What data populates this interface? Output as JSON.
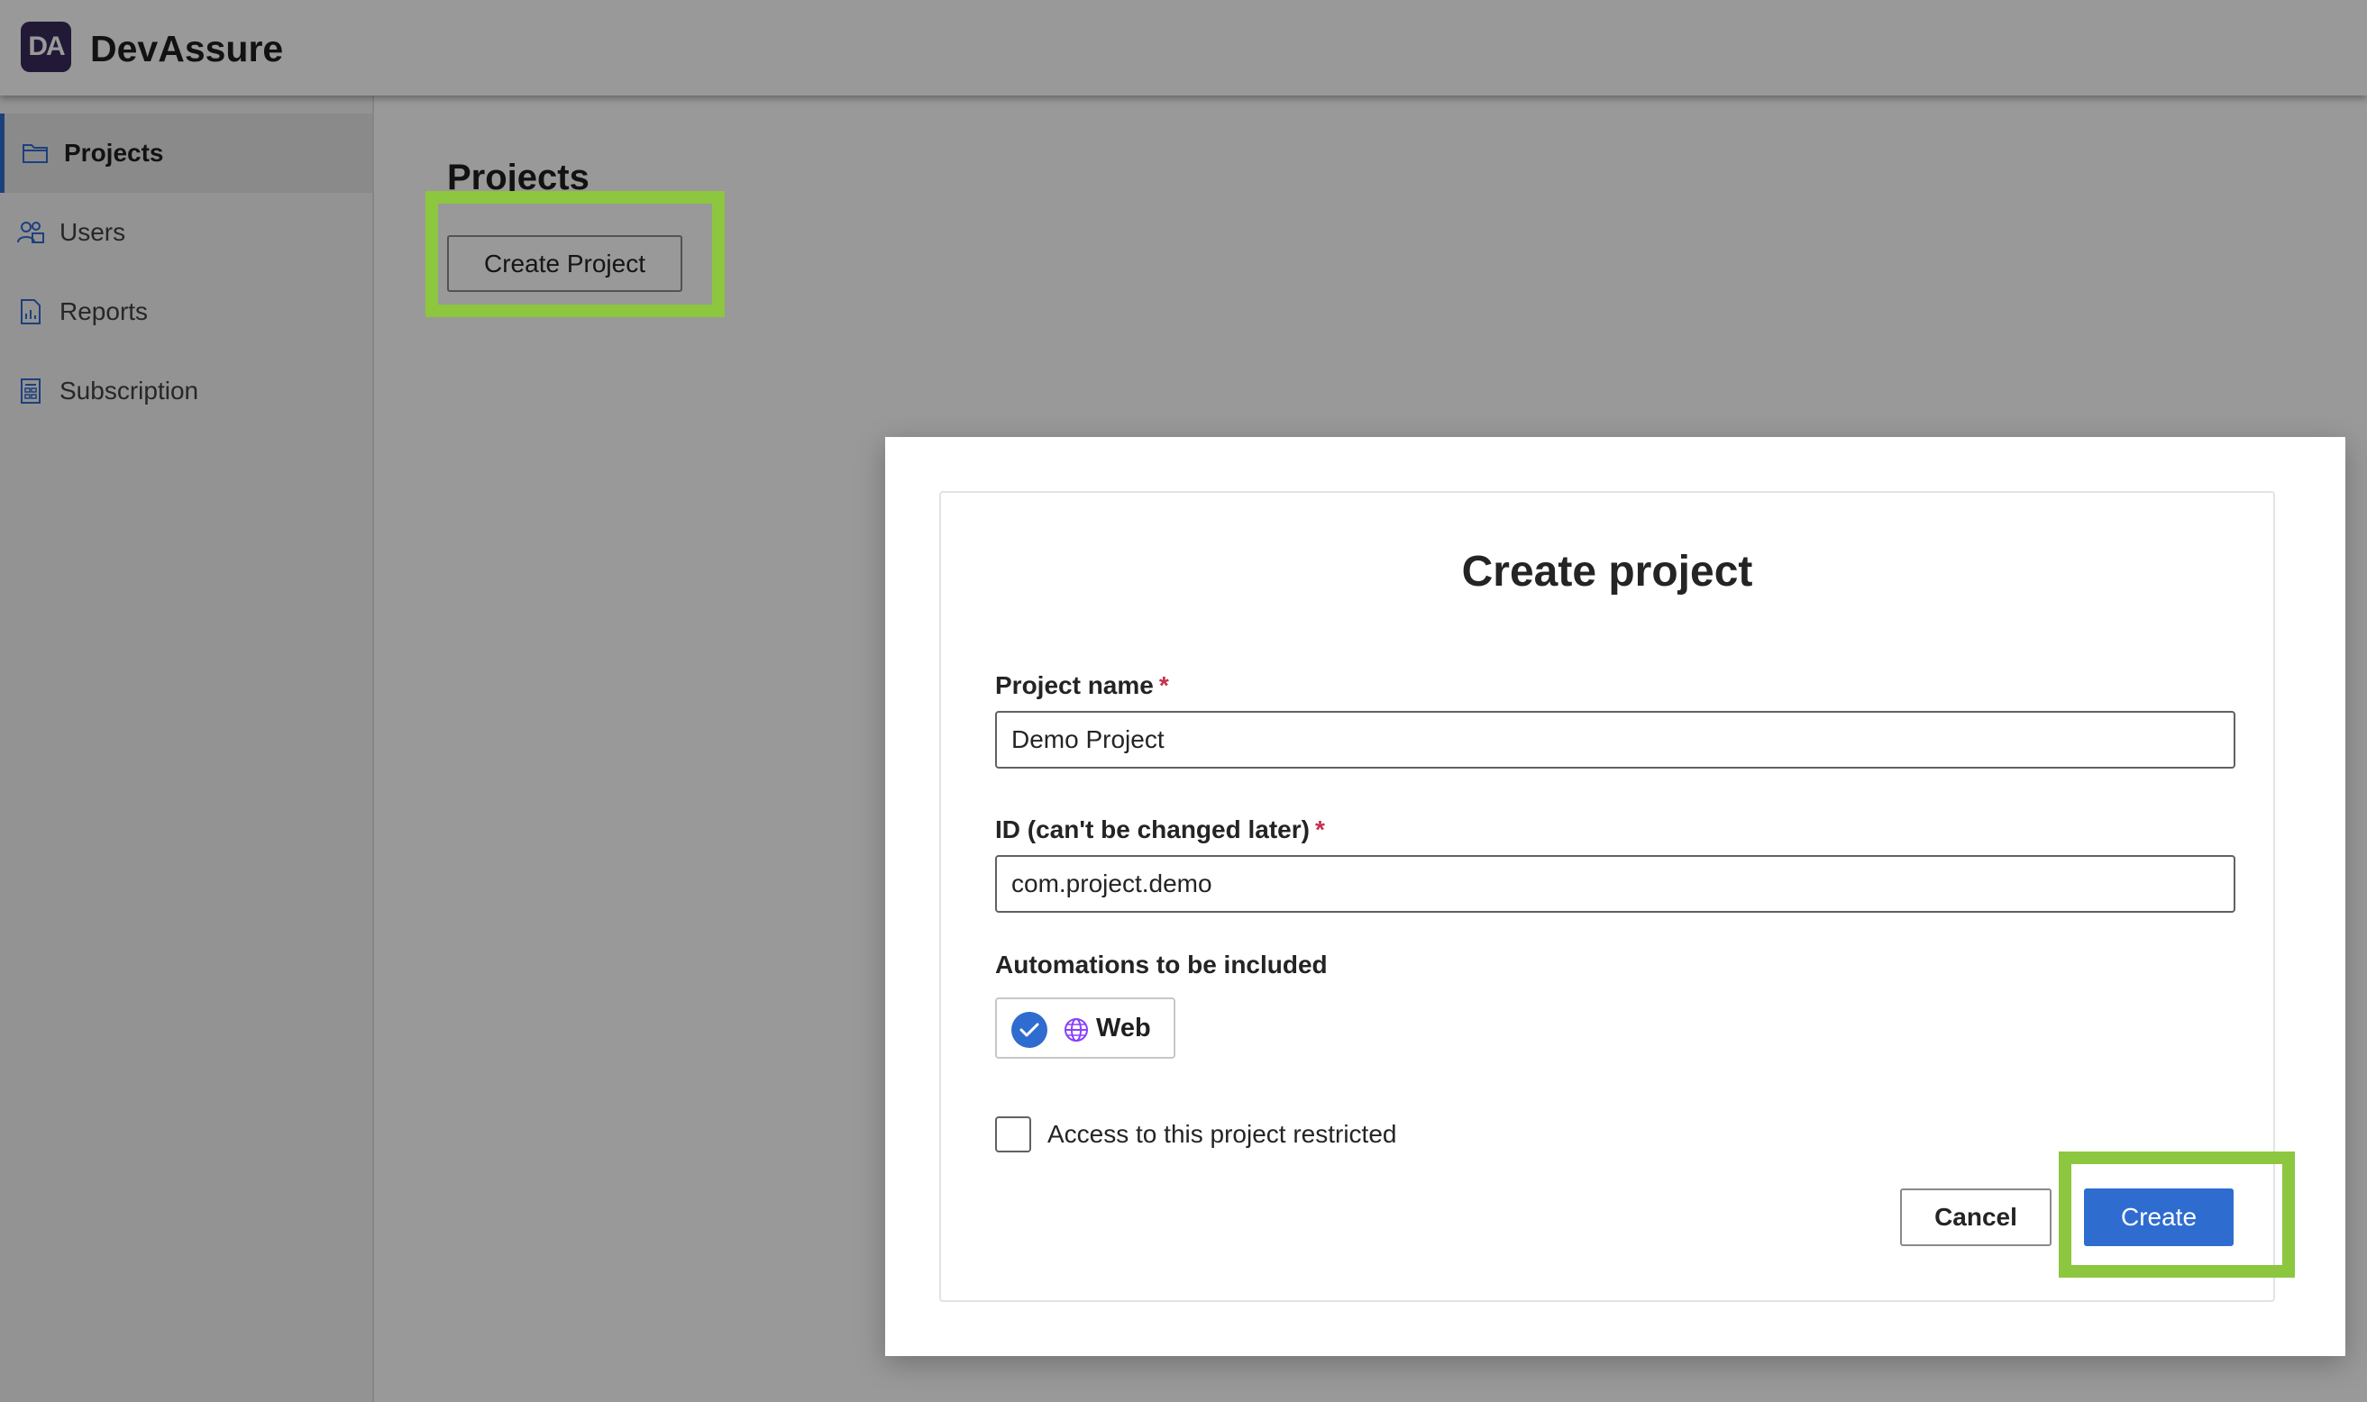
{
  "app": {
    "logo_text": "DA",
    "name": "DevAssure"
  },
  "sidebar": {
    "items": [
      {
        "label": "Projects",
        "icon": "folder-icon",
        "active": true
      },
      {
        "label": "Users",
        "icon": "users-icon",
        "active": false
      },
      {
        "label": "Reports",
        "icon": "report-icon",
        "active": false
      },
      {
        "label": "Subscription",
        "icon": "subscription-icon",
        "active": false
      }
    ]
  },
  "main": {
    "heading": "Projects",
    "create_button": "Create Project"
  },
  "dialog": {
    "title": "Create project",
    "project_name": {
      "label": "Project name",
      "required_marker": "*",
      "value": "Demo Project"
    },
    "project_id": {
      "label": "ID (can't be changed later)",
      "required_marker": "*",
      "value": "com.project.demo"
    },
    "automations": {
      "label": "Automations to be included",
      "options": [
        {
          "label": "Web",
          "icon": "globe-icon",
          "selected": true
        }
      ]
    },
    "restricted": {
      "label": "Access to this project restricted",
      "checked": false
    },
    "cancel_button": "Cancel",
    "create_button": "Create"
  },
  "colors": {
    "accent": "#2f6ccf",
    "highlight": "#8dc63f",
    "required": "#c4314b",
    "logo_bg": "#3a2a5c",
    "globe": "#8a3ffc"
  }
}
